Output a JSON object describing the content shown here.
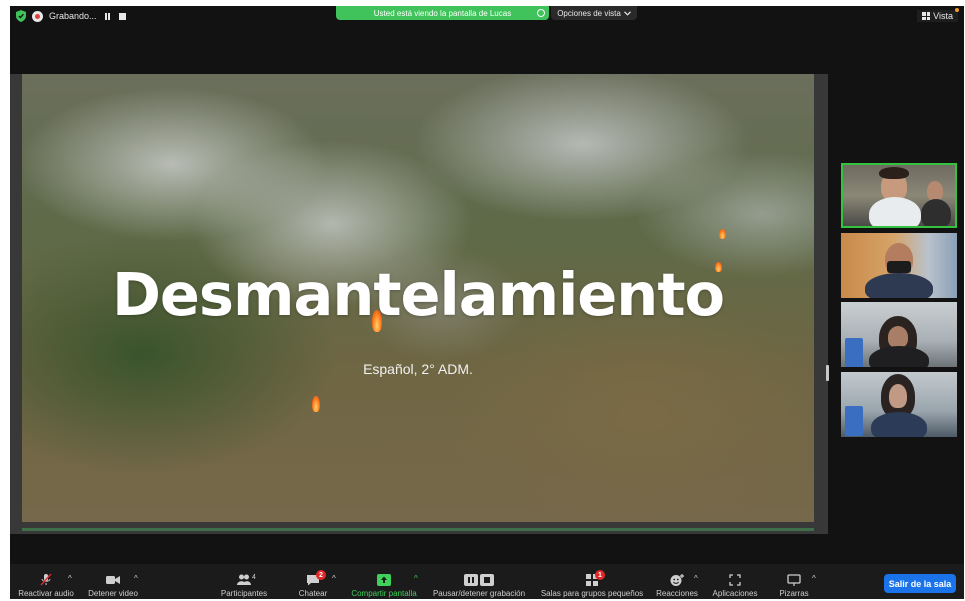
{
  "recording": {
    "label": "Grabando..."
  },
  "share_banner": {
    "text": "Usted está viendo la pantalla de Lucas"
  },
  "view_options": {
    "label": "Opciones de vista"
  },
  "view_button": {
    "label": "Vista"
  },
  "slide": {
    "title": "Desmantelamiento",
    "subtitle": "Español, 2° ADM."
  },
  "toolbar": {
    "mute": "Reactivar audio",
    "video": "Detener video",
    "participants": "Participantes",
    "participants_count": "4",
    "chat": "Chatear",
    "chat_badge": "2",
    "share": "Compartir pantalla",
    "record": "Pausar/detener grabación",
    "breakout": "Salas para grupos pequeños",
    "breakout_badge": "1",
    "reactions": "Reacciones",
    "apps": "Aplicaciones",
    "whiteboards": "Pizarras",
    "leave": "Salir de la sala"
  },
  "colors": {
    "accent_green": "#3fc35a",
    "leave_blue": "#1a73e8",
    "badge_red": "#e02828",
    "recording_red": "#e0403c"
  },
  "icons": [
    "shield-icon",
    "record-icon",
    "pause-icon",
    "stop-icon",
    "grid-view-icon",
    "microphone-muted-icon",
    "video-camera-icon",
    "participants-icon",
    "chat-icon",
    "share-screen-icon",
    "record-pause-icon",
    "breakout-rooms-icon",
    "reactions-icon",
    "apps-icon",
    "whiteboard-icon"
  ]
}
